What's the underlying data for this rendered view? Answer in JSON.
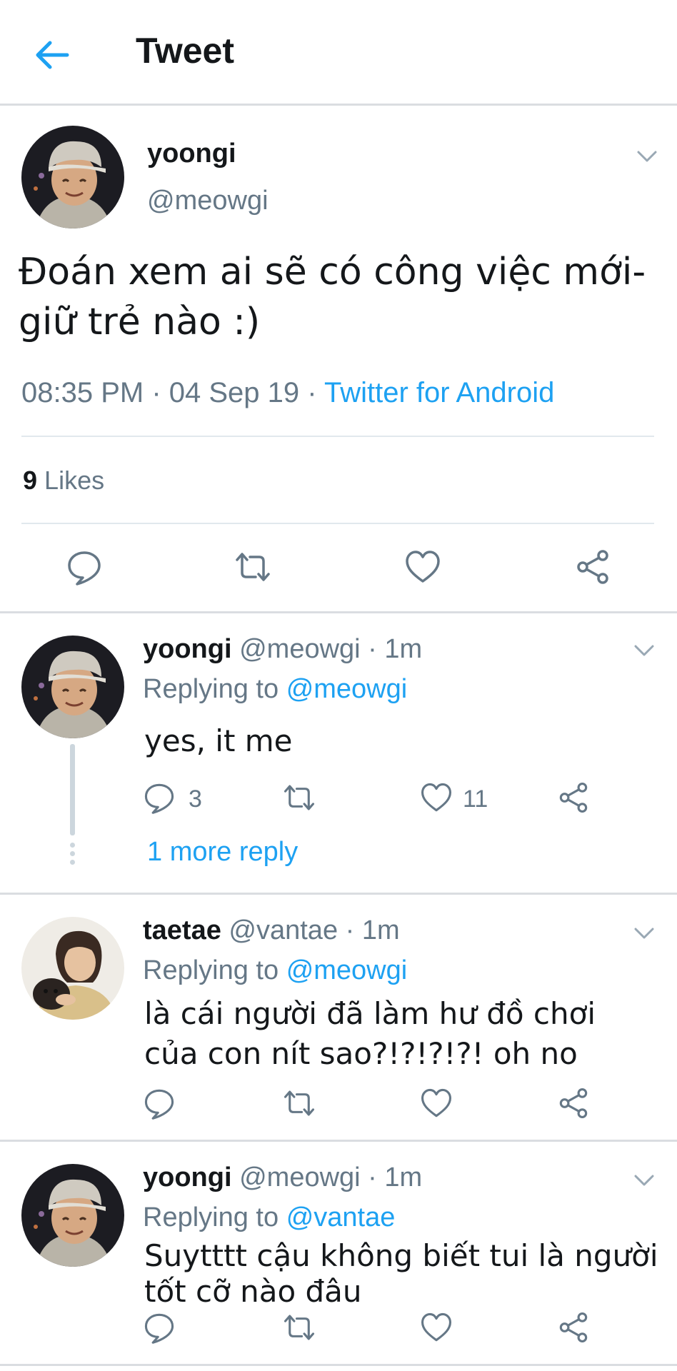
{
  "header": {
    "title": "Tweet"
  },
  "main_tweet": {
    "name": "yoongi",
    "handle": "@meowgi",
    "text": "Đoán xem ai sẽ có công việc mới-giữ trẻ nào :)",
    "time": "08:35 PM · 04 Sep 19 · ",
    "source": "Twitter for Android",
    "likes_count": "9",
    "likes_label": "Likes"
  },
  "replies": [
    {
      "name": "yoongi",
      "handle_time": "@meowgi · 1m",
      "replying_prefix": "Replying to",
      "replying_to": "@meowgi",
      "text": "yes, it me",
      "reply_count": "3",
      "like_count": "11",
      "more_replies": "1 more reply"
    },
    {
      "name": "taetae",
      "handle_time": "@vantae · 1m",
      "replying_prefix": "Replying to",
      "replying_to": "@meowgi",
      "text": "là cái người đã làm hư đồ chơi của con nít sao?!?!?!?! oh no"
    },
    {
      "name": "yoongi",
      "handle_time": "@meowgi · 1m",
      "replying_prefix": "Replying to",
      "replying_to": "@vantae",
      "text": "Suytttt cậu không biết tui là người tốt cỡ nào đâu"
    }
  ],
  "colors": {
    "accent": "#1da1f2",
    "secondary_text": "#657786",
    "divider": "#e1e8ed"
  }
}
